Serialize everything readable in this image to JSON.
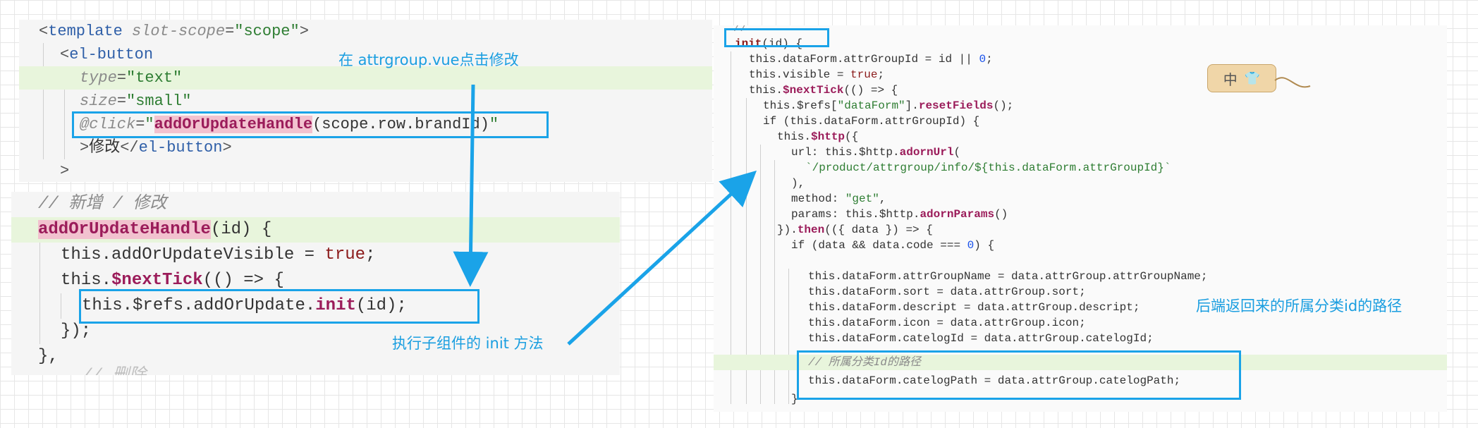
{
  "template_panel": {
    "lines": [
      {
        "p1": "<",
        "tag1": "template",
        "attr1": " slot-scope",
        "p2": "=",
        "str1": "\"scope\"",
        "p3": ">"
      },
      {
        "p1": "<",
        "tag1": "el-button"
      },
      {
        "attr1": "type",
        "p2": "=",
        "str1": "\"text\""
      },
      {
        "attr1": "size",
        "p2": "=",
        "str1": "\"small\""
      },
      {
        "attr1": "@click",
        "p2": "=",
        "str1": "\"",
        "fn": "addOrUpdateHandle",
        "rest": "(scope.row.brandId)",
        "str2": "\""
      },
      {
        "p1": ">",
        "text": "修改",
        "p2": "</",
        "tag1": "el-button",
        "p3": ">"
      },
      {
        "p1": ">"
      }
    ]
  },
  "handler_panel": {
    "lines": [
      {
        "cmt": "// 新增 / 修改"
      },
      {
        "fn": "addOrUpdateHandle",
        "rest": "(id) {"
      },
      {
        "a": "this.addOrUpdateVisible = ",
        "b": "true",
        "c": ";"
      },
      {
        "a": "this.",
        "fn": "$nextTick",
        "c": "(() => {"
      },
      {
        "a": "this.$refs.addOrUpdate.",
        "fn": "init",
        "c": "(id);"
      },
      {
        "a": "});"
      },
      {
        "a": "},"
      },
      {
        "cmt": "// 删除"
      }
    ]
  },
  "init_panel": {
    "lines": [
      {
        "t": "//"
      },
      {
        "fn": "init",
        "t": "(id) {"
      },
      {
        "t": "this.dataForm.attrGroupId = id || ",
        "n": "0",
        "t2": ";"
      },
      {
        "t": "this.visible = ",
        "b": "true",
        "t2": ";"
      },
      {
        "t": "this.",
        "fn": "$nextTick",
        "t2": "(() => {"
      },
      {
        "t": "this.$refs[",
        "s": "\"dataForm\"",
        "t2": "].",
        "fn": "resetFields",
        "t3": "();"
      },
      {
        "t": "if (this.dataForm.attrGroupId) {"
      },
      {
        "t": "this.",
        "fn": "$http",
        "t2": "({"
      },
      {
        "t": "url: this.$http.",
        "fn": "adornUrl",
        "t2": "("
      },
      {
        "s": "`/product/attrgroup/info/${this.dataForm.attrGroupId}`"
      },
      {
        "t": "),"
      },
      {
        "t": "method: ",
        "s": "\"get\"",
        "t2": ","
      },
      {
        "t": "params: this.$http.",
        "fn": "adornParams",
        "t2": "()"
      },
      {
        "t": "}).",
        "fn": "then",
        "t2": "(({ data }) => {"
      },
      {
        "t": "if (data && data.code === ",
        "n": "0",
        "t2": ") {"
      },
      {
        "t": "this.dataForm.attrGroupName = data.attrGroup.attrGroupName;"
      },
      {
        "t": "this.dataForm.sort = data.attrGroup.sort;"
      },
      {
        "t": "this.dataForm.descript = data.attrGroup.descript;"
      },
      {
        "t": "this.dataForm.icon = data.attrGroup.icon;"
      },
      {
        "t": "this.dataForm.catelogId = data.attrGroup.catelogId;"
      },
      {
        "cmt": "// 所属分类Id的路径"
      },
      {
        "t": "this.dataForm.catelogPath = data.attrGroup.catelogPath;"
      },
      {
        "t": "}"
      }
    ]
  },
  "annotations": {
    "click_edit": "在 attrgroup.vue点击修改",
    "exec_init": "执行子组件的 init 方法",
    "backend_path": "后端返回来的所属分类id的路径"
  },
  "tag_widget": {
    "text": "中",
    "icon": "shirt-icon"
  },
  "colors": {
    "accent": "#1aa3e8",
    "highlight_bg": "#e8f5dc",
    "fn_highlight": "#f2c2cf"
  }
}
